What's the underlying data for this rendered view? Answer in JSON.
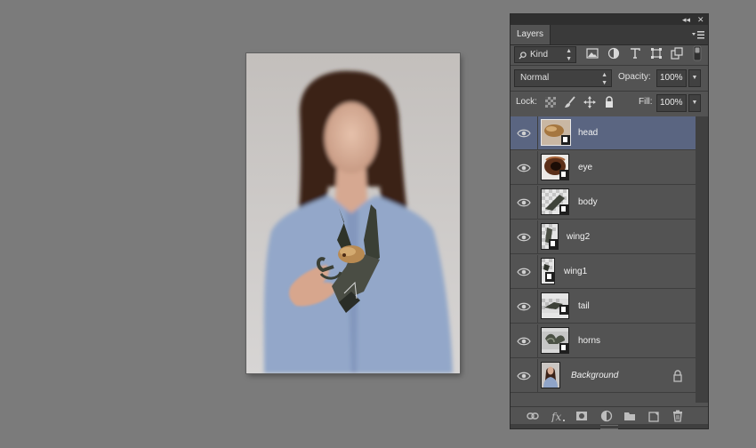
{
  "canvas": {
    "alt": "Photo of a woman holding out her hand with a paper-craft dragon composite"
  },
  "panel": {
    "collapse_glyph": "◂◂",
    "close_glyph": "✕",
    "tab_label": "Layers",
    "filter": {
      "kind_label": "Kind",
      "filter_icons": [
        "image-filter-icon",
        "adjustment-filter-icon",
        "type-filter-icon",
        "shape-filter-icon",
        "smart-object-filter-icon",
        "filter-toggle-icon"
      ]
    },
    "blend_mode": "Normal",
    "opacity_label": "Opacity:",
    "opacity_value": "100%",
    "lock_label": "Lock:",
    "fill_label": "Fill:",
    "fill_value": "100%",
    "layers": [
      {
        "name": "head",
        "selected": true,
        "thumb": "head"
      },
      {
        "name": "eye",
        "selected": false,
        "thumb": "eye"
      },
      {
        "name": "body",
        "selected": false,
        "thumb": "body"
      },
      {
        "name": "wing2",
        "selected": false,
        "thumb": "wing2"
      },
      {
        "name": "wing1",
        "selected": false,
        "thumb": "wing1"
      },
      {
        "name": "tail",
        "selected": false,
        "thumb": "tail"
      },
      {
        "name": "horns",
        "selected": false,
        "thumb": "horns"
      },
      {
        "name": "Background",
        "selected": false,
        "thumb": "background",
        "locked": true
      }
    ],
    "bottom_icons": [
      "link-layers-icon",
      "fx-icon",
      "add-mask-icon",
      "adjustment-layer-icon",
      "new-group-icon",
      "new-layer-icon",
      "delete-layer-icon"
    ]
  },
  "colors": {
    "workspace": "#7b7b7b",
    "panel": "#535353",
    "selected_layer": "#5a6581"
  }
}
